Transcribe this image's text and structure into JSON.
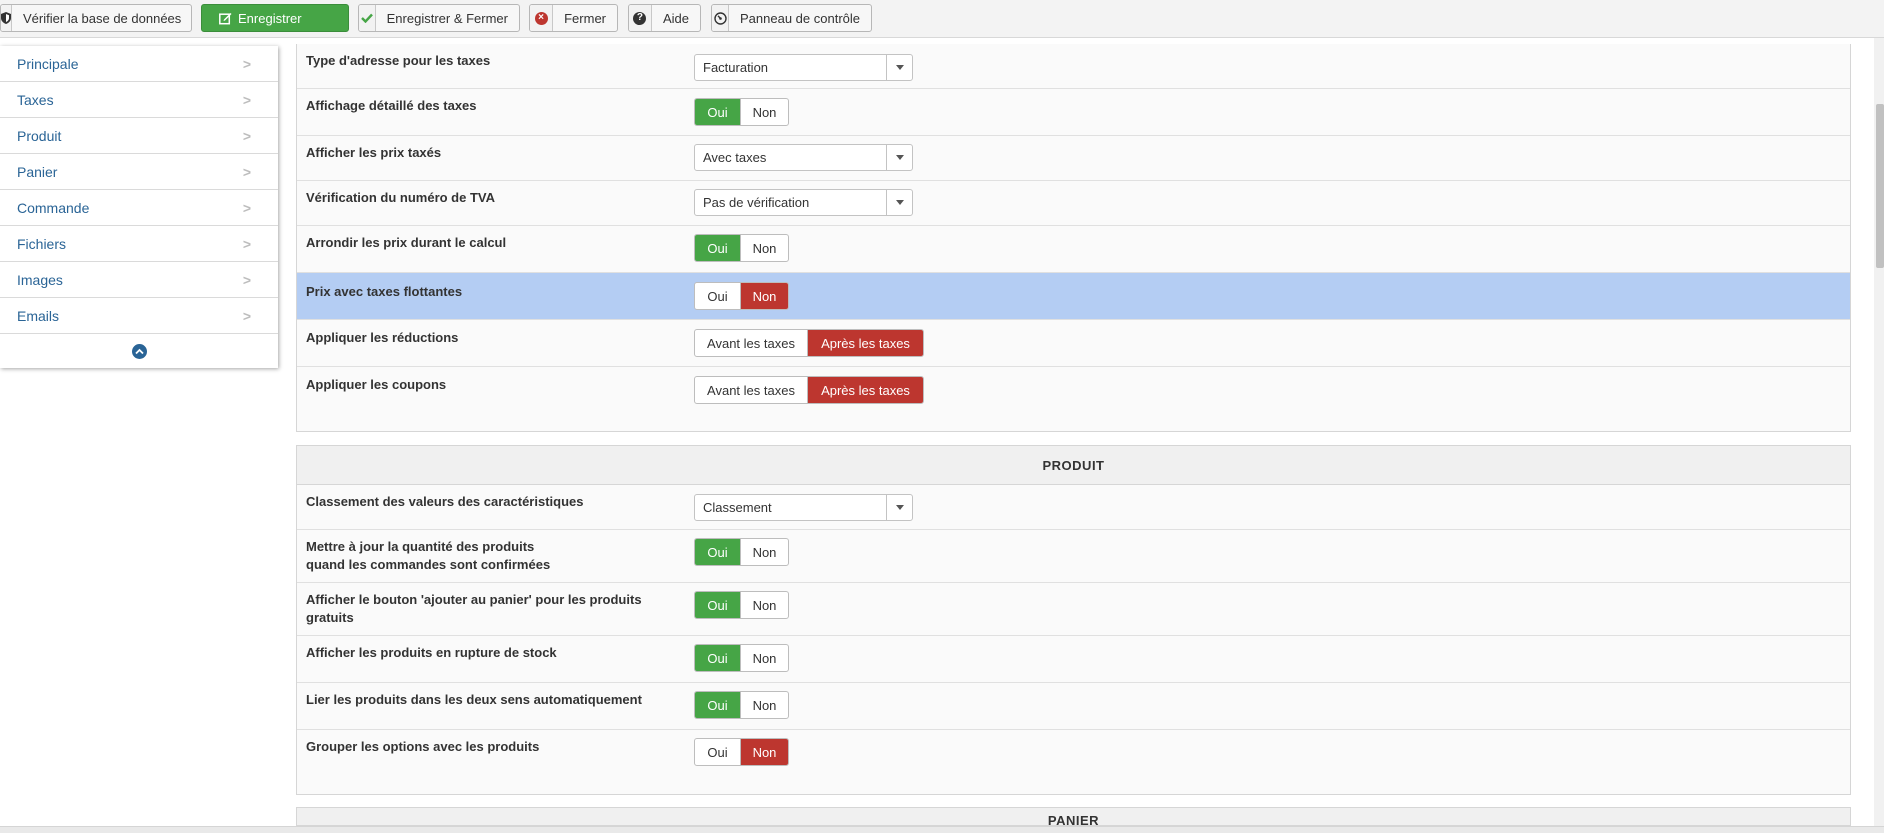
{
  "toolbar": {
    "verify_db": "Vérifier la base de données",
    "save": "Enregistrer",
    "save_close": "Enregistrer & Fermer",
    "close": "Fermer",
    "help": "Aide",
    "control_panel": "Panneau de contrôle"
  },
  "sidebar": {
    "items": [
      {
        "label": "Principale"
      },
      {
        "label": "Taxes"
      },
      {
        "label": "Produit"
      },
      {
        "label": "Panier"
      },
      {
        "label": "Commande"
      },
      {
        "label": "Fichiers"
      },
      {
        "label": "Images"
      },
      {
        "label": "Emails"
      }
    ]
  },
  "taxes": {
    "rows": [
      {
        "label": "Type d'adresse pour les taxes",
        "value": "Facturation"
      },
      {
        "label": "Affichage détaillé des taxes",
        "yes": "Oui",
        "no": "Non",
        "selected": "yes"
      },
      {
        "label": "Afficher les prix taxés",
        "value": "Avec taxes"
      },
      {
        "label": "Vérification du numéro de TVA",
        "value": "Pas de vérification"
      },
      {
        "label": "Arrondir les prix durant le calcul",
        "yes": "Oui",
        "no": "Non",
        "selected": "yes"
      },
      {
        "label": "Prix avec taxes flottantes",
        "yes": "Oui",
        "no": "Non",
        "selected": "no"
      },
      {
        "label": "Appliquer les réductions",
        "before": "Avant les taxes",
        "after": "Après les taxes",
        "selected": "after"
      },
      {
        "label": "Appliquer les coupons",
        "before": "Avant les taxes",
        "after": "Après les taxes",
        "selected": "after"
      }
    ]
  },
  "produit": {
    "title": "PRODUIT",
    "rows": [
      {
        "label": "Classement des valeurs des caractéristiques",
        "value": "Classement"
      },
      {
        "label_line1": "Mettre à jour la quantité des produits",
        "label_line2": "quand les commandes sont confirmées",
        "yes": "Oui",
        "no": "Non",
        "selected": "yes"
      },
      {
        "label_line1": "Afficher le bouton 'ajouter au panier' pour les produits",
        "label_line2": "gratuits",
        "yes": "Oui",
        "no": "Non",
        "selected": "yes"
      },
      {
        "label": "Afficher les produits en rupture de stock",
        "yes": "Oui",
        "no": "Non",
        "selected": "yes"
      },
      {
        "label": "Lier les produits dans les deux sens automatiquement",
        "yes": "Oui",
        "no": "Non",
        "selected": "yes"
      },
      {
        "label": "Grouper les options avec les produits",
        "yes": "Oui",
        "no": "Non",
        "selected": "no"
      }
    ]
  },
  "panier": {
    "title": "PANIER"
  },
  "colors": {
    "green": "#46a546",
    "red": "#bd362f",
    "highlight": "#b4cdf3",
    "link": "#2a6496"
  }
}
